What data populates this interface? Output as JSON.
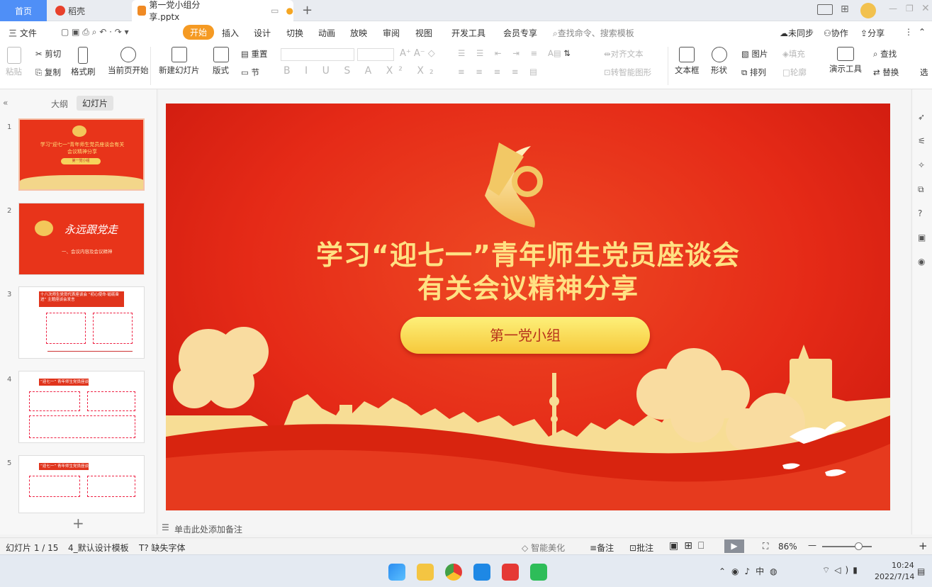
{
  "tabs": {
    "home": "首页",
    "daoke": "稻壳",
    "document": "第一党小组分享.pptx"
  },
  "menu": {
    "file": "三 文件",
    "items": [
      "开始",
      "插入",
      "设计",
      "切换",
      "动画",
      "放映",
      "审阅",
      "视图",
      "开发工具",
      "会员专享"
    ],
    "search": "查找命令、搜索模板",
    "sync": "未同步",
    "collab": "协作",
    "share": "分享"
  },
  "ribbon": {
    "paste": "粘贴",
    "cut": "剪切",
    "copy": "复制",
    "format_painter": "格式刷",
    "play_current": "当前页开始",
    "new_slide": "新建幻灯片",
    "layout": "版式",
    "section": "节",
    "reset": "重置",
    "align_text": "对齐文本",
    "smartart": "转智能图形",
    "textbox": "文本框",
    "shape": "形状",
    "picture": "图片",
    "fill": "填充",
    "outline": "轮廓",
    "arrange": "排列",
    "presenter": "演示工具",
    "find": "查找",
    "replace": "替换",
    "select": "选"
  },
  "panel": {
    "outline_tab": "大纲",
    "slides_tab": "幻灯片"
  },
  "thumbs": [
    {
      "num": "1",
      "title": "学习\"迎七一\"青年师生党员座谈会有关会议精神分享",
      "sub": "第一党小组"
    },
    {
      "num": "2",
      "title": "永远跟党走",
      "sub": "一、会议内容及会议精神"
    },
    {
      "num": "3",
      "title": "十八次师生党员代表座谈会 “初心使命·砥砺奋进” 主题座谈会发言"
    },
    {
      "num": "4",
      "title": "“迎七一” 青年师生党员座谈会"
    },
    {
      "num": "5",
      "title": "“迎七一” 青年师生党员座谈会"
    }
  ],
  "slide": {
    "title1": "学习“迎七一”青年师生党员座谈会",
    "title2": "有关会议精神分享",
    "button": "第一党小组"
  },
  "notes": "单击此处添加备注",
  "status": {
    "slide_count": "幻灯片 1 / 15",
    "template": "4_默认设计模板",
    "missing_font": "缺失字体",
    "beautify": "智能美化",
    "notes": "备注",
    "comment": "批注",
    "zoom": "86%"
  },
  "taskbar": {
    "time": "10:24",
    "date": "2022/7/14"
  }
}
